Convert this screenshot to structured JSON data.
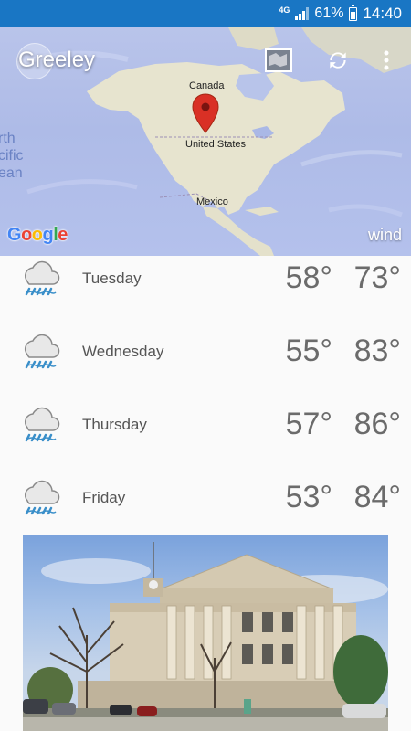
{
  "status_bar": {
    "network": "4G",
    "battery": "61%",
    "time": "14:40"
  },
  "map": {
    "city": "Greeley",
    "labels": {
      "canada": "Canada",
      "us": "United States",
      "mexico": "Mexico",
      "ocean": [
        "rth",
        "cific",
        "ean"
      ]
    },
    "provider": "Google",
    "layer": "wind",
    "colors": {
      "ocean": "#b4c1ec",
      "land": "#e6e3cc",
      "pin": "#d93025",
      "statusbar": "#1976c4"
    }
  },
  "forecast": [
    {
      "day": "Tuesday",
      "low": "58°",
      "high": "73°",
      "icon": "rain-cloud-icon"
    },
    {
      "day": "Wednesday",
      "low": "55°",
      "high": "83°",
      "icon": "rain-cloud-icon"
    },
    {
      "day": "Thursday",
      "low": "57°",
      "high": "86°",
      "icon": "rain-cloud-icon"
    },
    {
      "day": "Friday",
      "low": "53°",
      "high": "84°",
      "icon": "rain-cloud-icon"
    }
  ]
}
